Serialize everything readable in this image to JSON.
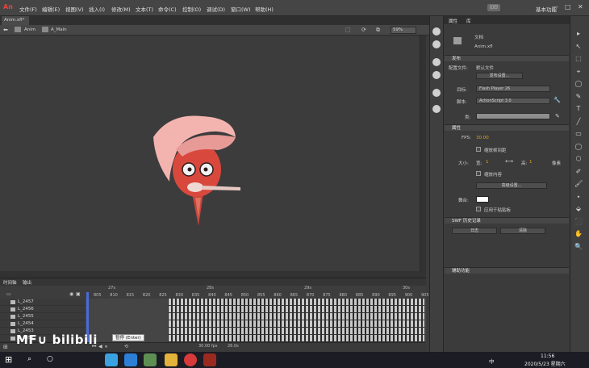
{
  "app": {
    "logo": "An",
    "menu": [
      "文件(F)",
      "编辑(E)",
      "视图(V)",
      "插入(I)",
      "修改(M)",
      "文本(T)",
      "命令(C)",
      "控制(O)",
      "调试(D)",
      "窗口(W)",
      "帮助(H)"
    ],
    "workspace_switch": "◱◳",
    "workspace": "基本功能",
    "window_buttons": [
      "—",
      "□",
      "✕"
    ]
  },
  "document": {
    "tab": "Anim.xfl*",
    "breadcrumbs": [
      "Anim",
      "A_Main"
    ],
    "zoom": "59%"
  },
  "timeline": {
    "tabs": [
      "时间轴",
      "输出"
    ],
    "layers": [
      "L_2457",
      "L_2456",
      "L_2455",
      "L_2454",
      "L_2453",
      "L_2452"
    ],
    "seconds_labels": [
      "27s",
      "28s",
      "29s",
      "30s"
    ],
    "frame_numbers": [
      "805",
      "810",
      "815",
      "820",
      "825",
      "830",
      "835",
      "840",
      "845",
      "850",
      "855",
      "860",
      "865",
      "870",
      "875",
      "880",
      "885",
      "890",
      "895",
      "900",
      "905"
    ],
    "tooltip": "暂停 (Enter)",
    "status_fps": "30.00 fps",
    "status_frame": "26.0s"
  },
  "watermark": "MF∪ bilibili",
  "properties": {
    "tabs": [
      "属性",
      "库"
    ],
    "doc_type": "文档",
    "doc_name": "Anim.xfl",
    "section_publish": "发布",
    "config_label": "配置文件:",
    "config_value": "默认文件",
    "publish_settings_button": "发布设置...",
    "target_label": "目标:",
    "target_value": "Flash Player 26",
    "script_label": "脚本:",
    "script_value": "ActionScript 3.0",
    "class_label": "类:",
    "class_value": "",
    "section_properties": "属性",
    "fps_label": "FPS:",
    "fps_value": "30.00",
    "scale_spans": "缩放帧间距",
    "size_label": "大小:",
    "width_label": "宽:",
    "width_value": "1",
    "height_label": "高:",
    "height_value": "1",
    "unit": "像素",
    "scale_content": "缩放内容",
    "advanced_button": "高级设置...",
    "stage_label": "舞台:",
    "stage_color": "#ffffff",
    "apply_pasteboard": "应用于粘贴板",
    "section_swf": "SWF 历史记录",
    "log_button": "日志",
    "clear_button": "清除",
    "section_accessibility": "辅助功能"
  },
  "taskbar": {
    "lang": "中",
    "time": "11:56",
    "date": "2020/5/23 星期六"
  }
}
